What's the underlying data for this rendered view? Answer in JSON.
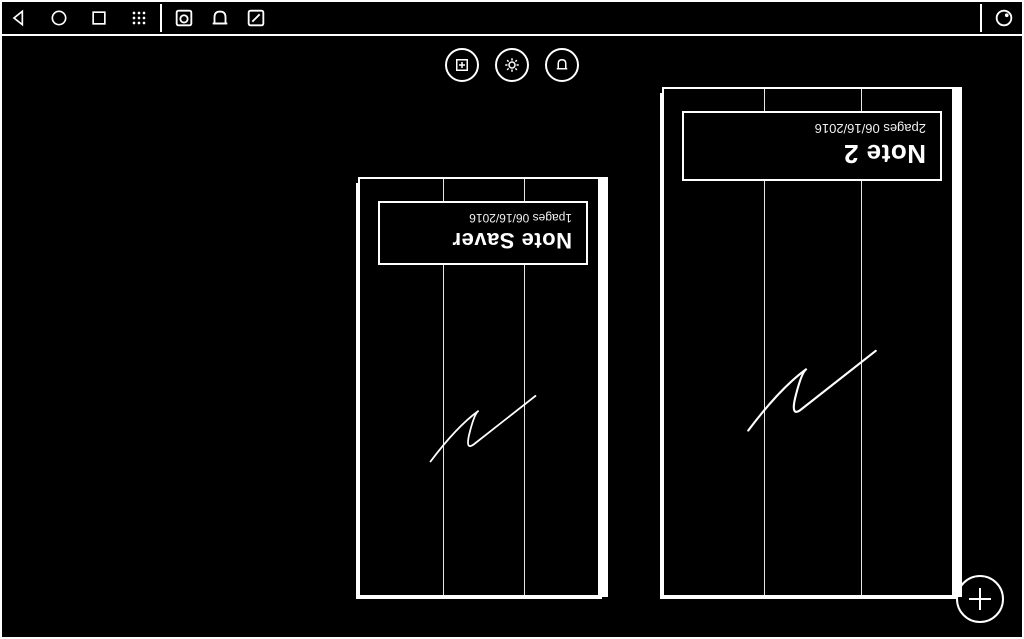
{
  "statusbar": {
    "nav": {
      "back": "back",
      "home": "home",
      "recent": "recent",
      "apps": "apps"
    },
    "tray": {
      "item1": "camera",
      "item2": "notification",
      "item3": "pen"
    },
    "right": {
      "item1": "status"
    }
  },
  "actions": {
    "new_note": "new-note",
    "settings": "settings",
    "reminder": "reminder"
  },
  "notes": [
    {
      "title": "Note Saver",
      "pages": "1pages",
      "date": "06/16/2016"
    },
    {
      "title": "Note 2",
      "pages": "2pages",
      "date": "06/16/2016"
    }
  ],
  "fab": {
    "label": "add"
  }
}
